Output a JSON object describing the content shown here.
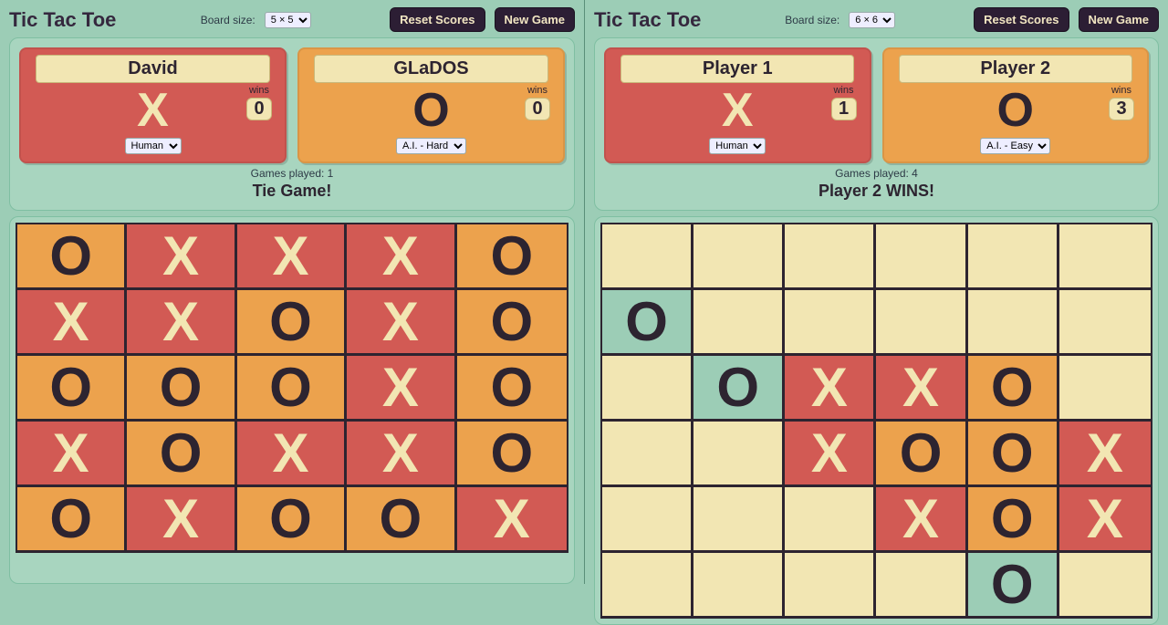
{
  "common": {
    "title": "Tic Tac Toe",
    "board_size_label": "Board size:",
    "reset_scores": "Reset Scores",
    "new_game": "New Game",
    "wins_label": "wins",
    "symX": "X",
    "symO": "O"
  },
  "left": {
    "board_size_value": "5 × 5",
    "players": [
      {
        "name": "David",
        "symbol": "X",
        "wins": 0,
        "type": "Human"
      },
      {
        "name": "GLaDOS",
        "symbol": "O",
        "wins": 0,
        "type": "A.I. - Hard"
      }
    ],
    "games_played_label": "Games played: 1",
    "result": "Tie Game!",
    "board": [
      [
        "O",
        "X",
        "X",
        "X",
        "O"
      ],
      [
        "X",
        "X",
        "O",
        "X",
        "O"
      ],
      [
        "O",
        "O",
        "O",
        "X",
        "O"
      ],
      [
        "X",
        "O",
        "X",
        "X",
        "O"
      ],
      [
        "O",
        "X",
        "O",
        "O",
        "X"
      ]
    ]
  },
  "right": {
    "board_size_value": "6 × 6",
    "players": [
      {
        "name": "Player 1",
        "symbol": "X",
        "wins": 1,
        "type": "Human"
      },
      {
        "name": "Player 2",
        "symbol": "O",
        "wins": 3,
        "type": "A.I. - Easy"
      }
    ],
    "games_played_label": "Games played: 4",
    "result": "Player 2 WINS!",
    "winning_cells": [
      [
        1,
        0
      ],
      [
        2,
        1
      ],
      [
        3,
        2
      ],
      [
        4,
        3
      ],
      [
        5,
        4
      ]
    ],
    "board": [
      [
        "",
        "",
        "",
        "",
        "",
        ""
      ],
      [
        "O",
        "",
        "",
        "",
        "",
        ""
      ],
      [
        "",
        "O",
        "X",
        "X",
        "O",
        ""
      ],
      [
        "",
        "",
        "X",
        "O",
        "O",
        "X"
      ],
      [
        "",
        "",
        "",
        "X",
        "O",
        "X"
      ],
      [
        "",
        "",
        "",
        "",
        "O",
        ""
      ]
    ]
  }
}
